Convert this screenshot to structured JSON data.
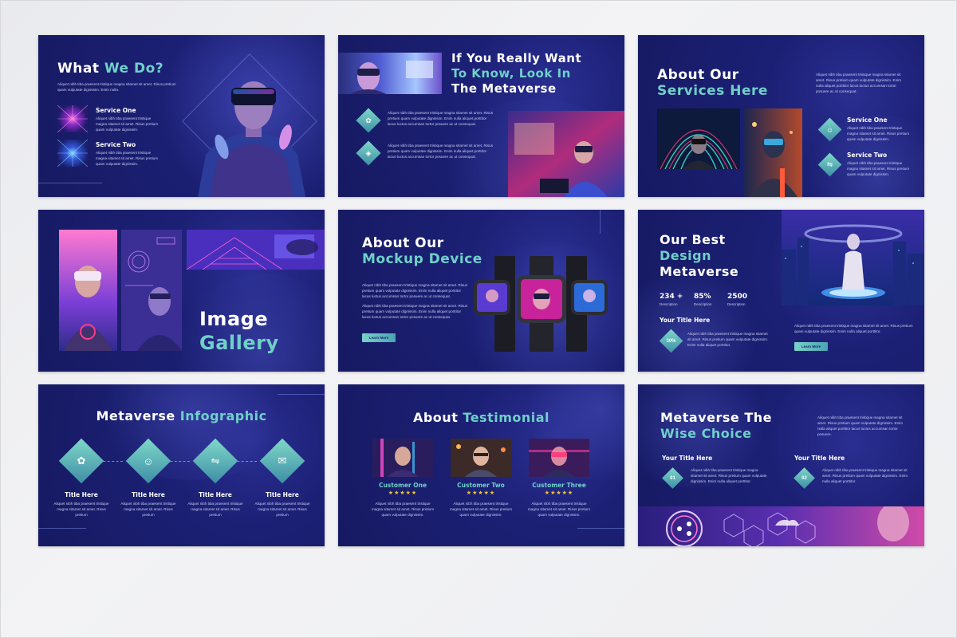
{
  "colors": {
    "slide_bg": "#1c2075",
    "accent_teal": "#6fd0c9",
    "star": "#f7c82d"
  },
  "lorem_short": "Aliquet nibh tiba praesent tristique magna sitamet sit amet. Risus pretium quam vulputate dignissim.",
  "lorem_long": "Aliquet nibh tiba praesent tristique magna sitamet sit amet. Risus pretium quam vulputate dignissim. Enim nulla aliquet porttitor lacus luctus accumsan tortor posuere ac ut consequat.",
  "slide1": {
    "title_a": "What ",
    "title_b": "We Do?",
    "intro": "Aliquet nibh tiba praesent tristique magna sitamet sit amet. Risus pretium quam vulputate dignissim. Enim nulla.",
    "services": [
      {
        "title": "Service One",
        "text": "Aliquet nibh tiba praesent tristique magna sitamet sit amet. Risus pretium quam vulputate dignissim."
      },
      {
        "title": "Service Two",
        "text": "Aliquet nibh tiba praesent tristique magna sitamet sit amet. Risus pretium quam vulputate dignissim."
      }
    ]
  },
  "slide2": {
    "title_l1": "If You Really Want",
    "title_l2": "To Know, Look In",
    "title_l3": "The Metaverse",
    "items": [
      {
        "icon": "flower-icon",
        "glyph": "✿",
        "text": "Aliquet nibh tiba praesent tristique magna sitamet sit amet. Risus pretium quam vulputate dignissim. Enim nulla aliquet porttitor lacus luctus accumsan tortor posuere ac ut consequat."
      },
      {
        "icon": "diamond-icon",
        "glyph": "◈",
        "text": "Aliquet nibh tiba praesent tristique magna sitamet sit amet. Risus pretium quam vulputate dignissim. Enim nulla aliquet porttitor lacus luctus accumsan tortor posuere ac ut consequat."
      }
    ]
  },
  "slide3": {
    "title_a": "About Our",
    "title_b": "Services Here",
    "intro": "Aliquet nibh tiba praesent tristique magna sitamet sit amet. Risus pretium quam vulputate dignissim. Enim nulla aliquet porttitor lacus luctus accumsan tortor posuere ac ut consequat.",
    "services": [
      {
        "title": "Service One",
        "icon": "head-icon",
        "glyph": "☺",
        "text": "Aliquet nibh tiba praesent tristique magna sitamet sit amet. Risus pretium quam vulputate dignissim."
      },
      {
        "title": "Service Two",
        "icon": "toggle-icon",
        "glyph": "⇋",
        "text": "Aliquet nibh tiba praesent tristique magna sitamet sit amet. Risus pretium quam vulputate dignissim."
      }
    ]
  },
  "slide4": {
    "title_a": "Image",
    "title_b": "Gallery"
  },
  "slide5": {
    "title_a": "About Our",
    "title_b": "Mockup Device",
    "text1": "Aliquet nibh tiba praesent tristique magna sitamet sit amet. Risus pretium quam vulputate dignissim. Enim nulla aliquet porttitor lacus luctus accumsan tortor posuere ac ut consequat.",
    "text2": "Aliquet nibh tiba praesent tristique magna sitamet sit amet. Risus pretium quam vulputate dignissim. Enim nulla aliquet porttitor lacus luctus accumsan tortor posuere ac ut consequat.",
    "button": "Learn More"
  },
  "slide6": {
    "title_a": "Our Best",
    "title_b": "Design",
    "title_c": "Metaverse",
    "stats": [
      {
        "value": "234 +",
        "label": "Description"
      },
      {
        "value": "85%",
        "label": "Description"
      },
      {
        "value": "2500",
        "label": "Description"
      }
    ],
    "subtitle": "Your Title Here",
    "badge": "30%",
    "badge_text": "Aliquet nibh tiba praesent tristique magna sitamet sit amet. Risus pretium quam vulputate dignissim. Enim nulla aliquet porttitor.",
    "right_text": "Aliquet nibh tiba praesent tristique magna sitamet sit amet. Risus pretium quam vulputate dignissim. Enim nulla aliquet porttitor.",
    "button": "Learn More"
  },
  "slide7": {
    "title_a": "Metaverse ",
    "title_b": "Infographic",
    "items": [
      {
        "icon": "flower-icon",
        "glyph": "✿",
        "title": "Title Here",
        "text": "Aliquet nibh tiba praesent tristique magna sitamet sit amet. Risus pretium"
      },
      {
        "icon": "head-icon",
        "glyph": "☺",
        "title": "Title Here",
        "text": "Aliquet nibh tiba praesent tristique magna sitamet sit amet. Risus pretium"
      },
      {
        "icon": "toggle-icon",
        "glyph": "⇋",
        "title": "Title Here",
        "text": "Aliquet nibh tiba praesent tristique magna sitamet sit amet. Risus pretium"
      },
      {
        "icon": "chat-icon",
        "glyph": "✉",
        "title": "Title Here",
        "text": "Aliquet nibh tiba praesent tristique magna sitamet sit amet. Risus pretium"
      }
    ]
  },
  "slide8": {
    "title_a": "About ",
    "title_b": "Testimonial",
    "customers": [
      {
        "name": "Customer One",
        "stars": "★★★★★",
        "text": "Aliquet nibh tiba praesent tristique magna sitamet sit amet. Risus pretium quam vulputate dignissim."
      },
      {
        "name": "Customer Two",
        "stars": "★★★★★",
        "text": "Aliquet nibh tiba praesent tristique magna sitamet sit amet. Risus pretium quam vulputate dignissim."
      },
      {
        "name": "Customer Three",
        "stars": "★★★★★",
        "text": "Aliquet nibh tiba praesent tristique magna sitamet sit amet. Risus pretium quam vulputate dignissim."
      }
    ]
  },
  "slide9": {
    "title_a": "Metaverse The",
    "title_b": "Wise Choice",
    "intro": "Aliquet nibh tiba praesent tristique magna sitamet sit amet. Risus pretium quam vulputate dignissim. Enim nulla aliquet porttitor lacus luctus accumsan tortor posuere.",
    "items": [
      {
        "title": "Your Title Here",
        "num": "01",
        "text": "Aliquet nibh tiba praesent tristique magna sitamet sit amet. Risus pretium quam vulputate dignissim. Enim nulla aliquet porttitor."
      },
      {
        "title": "Your Title Here",
        "num": "02",
        "text": "Aliquet nibh tiba praesent tristique magna sitamet sit amet. Risus pretium quam vulputate dignissim. Enim nulla aliquet porttitor."
      }
    ]
  }
}
